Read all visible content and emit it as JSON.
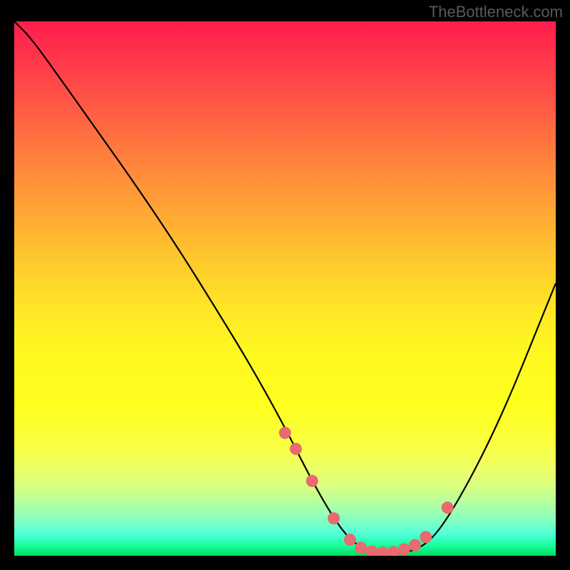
{
  "attribution": "TheBottleneck.com",
  "chart_data": {
    "type": "line",
    "title": "",
    "xlabel": "",
    "ylabel": "",
    "xlim": [
      0,
      100
    ],
    "ylim": [
      0,
      100
    ],
    "gradient": "red-yellow-green vertical",
    "series": [
      {
        "name": "bottleneck-curve",
        "x": [
          0,
          3,
          8,
          15,
          22,
          30,
          38,
          44,
          50,
          55,
          59,
          62,
          65,
          68,
          71,
          74,
          77,
          80,
          84,
          88,
          92,
          96,
          100
        ],
        "y": [
          100,
          97,
          90,
          80,
          70,
          58,
          45,
          35,
          24,
          14,
          7,
          3,
          1,
          0.5,
          0.5,
          1,
          3,
          7,
          14,
          22,
          31,
          41,
          51
        ]
      }
    ],
    "markers": {
      "name": "highlighted-points",
      "x": [
        50,
        52,
        55,
        59,
        62,
        64,
        66,
        68,
        70,
        72,
        74,
        76,
        80
      ],
      "y": [
        23,
        20,
        14,
        7,
        3,
        1.5,
        0.8,
        0.6,
        0.7,
        1.2,
        2,
        3.5,
        9
      ]
    }
  }
}
